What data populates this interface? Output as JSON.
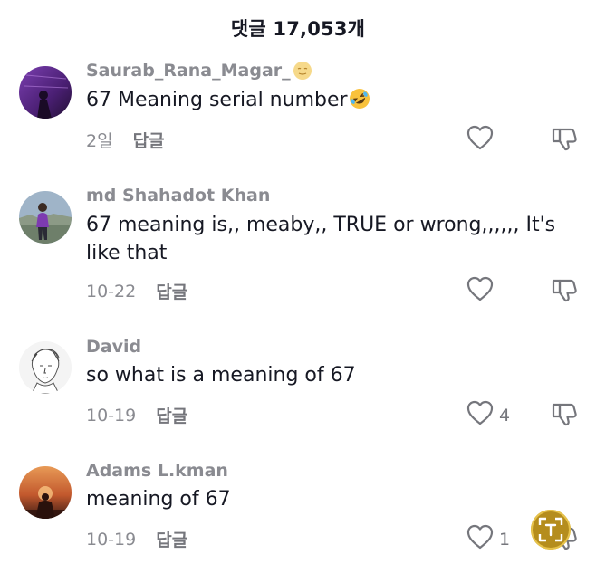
{
  "header": {
    "title": "댓글 17,053개"
  },
  "comments": [
    {
      "username": "Saurab_Rana_Magar_",
      "username_emoji": "smiling-face-icon",
      "text": "67 Meaning serial number",
      "text_emoji": "rolling-on-floor-laughing-icon",
      "date": "2일",
      "reply": "답글",
      "likes": ""
    },
    {
      "username": "md Shahadot Khan",
      "text": "67 meaning is,, meaby,, TRUE or wrong,,,,,, It's like that",
      "date": "10-22",
      "reply": "답글",
      "likes": ""
    },
    {
      "username": "David",
      "text": "so what is a meaning of 67",
      "date": "10-19",
      "reply": "답글",
      "likes": "4"
    },
    {
      "username": "Adams L.kman",
      "text": "meaning of 67",
      "date": "10-19",
      "reply": "답글",
      "likes": "1"
    }
  ],
  "icons": {
    "like": "heart-outline-icon",
    "dislike": "thumbs-down-icon",
    "scan": "scan-text-icon"
  },
  "colors": {
    "text": "#161823",
    "secondary": "#8a8b91",
    "icon": "#75767c",
    "scan_badge": "#b58d1d"
  }
}
